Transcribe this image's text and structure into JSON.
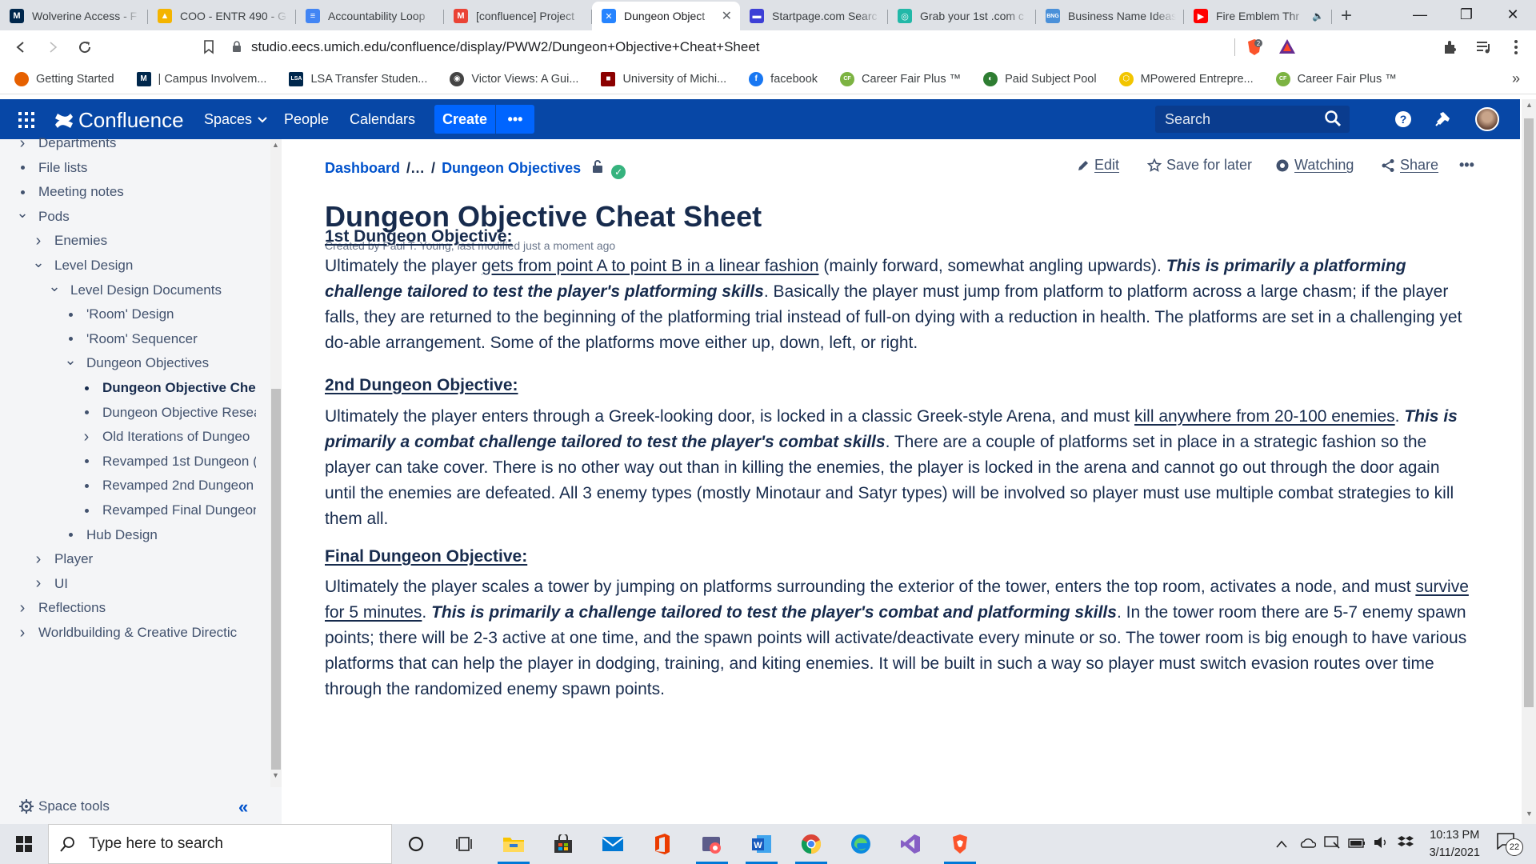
{
  "browser": {
    "tabs": [
      {
        "title": "Wolverine Access - F",
        "fav_color": "#00274c",
        "fav_text": "M"
      },
      {
        "title": "COO - ENTR 490 - G",
        "fav_color": "#f4b400",
        "fav_text": "▲"
      },
      {
        "title": "Accountability Loop",
        "fav_color": "#4285f4",
        "fav_text": "≡"
      },
      {
        "title": "[confluence] Project",
        "fav_color": "#ea4335",
        "fav_text": "M"
      },
      {
        "title": "Dungeon Object",
        "fav_color": "#2684ff",
        "fav_text": "✕"
      },
      {
        "title": "Startpage.com Searc",
        "fav_color": "#3d3fd6",
        "fav_text": "▬"
      },
      {
        "title": "Grab your 1st .com c",
        "fav_color": "#22b8a8",
        "fav_text": "◎"
      },
      {
        "title": "Business Name Ideas",
        "fav_color": "#4a90d9",
        "fav_text": "BNG"
      },
      {
        "title": "Fire Emblem Thr",
        "fav_color": "#ff0000",
        "fav_text": "▶"
      }
    ],
    "url": "studio.eecs.umich.edu/confluence/display/PWW2/Dungeon+Objective+Cheat+Sheet",
    "brave_badge": "2",
    "bookmarks": [
      {
        "label": "Getting Started",
        "color": "#e66000",
        "icon": ""
      },
      {
        "label": "| Campus Involvem...",
        "color": "#00274c",
        "icon": "M"
      },
      {
        "label": "LSA Transfer Studen...",
        "color": "#00274c",
        "icon": "LSA"
      },
      {
        "label": "Victor Views: A Gui...",
        "color": "#444444",
        "icon": "◉"
      },
      {
        "label": "University of Michi...",
        "color": "#8b0000",
        "icon": "■"
      },
      {
        "label": "facebook",
        "color": "#1877f2",
        "icon": "f"
      },
      {
        "label": "Career Fair Plus ™",
        "color": "#7cb342",
        "icon": "CF"
      },
      {
        "label": "Paid Subject Pool",
        "color": "#2e7d32",
        "icon": "◐"
      },
      {
        "label": "MPowered Entrepre...",
        "color": "#f2c500",
        "icon": "⬡"
      },
      {
        "label": "Career Fair Plus ™",
        "color": "#7cb342",
        "icon": "CF"
      }
    ]
  },
  "header": {
    "logo": "Confluence",
    "spaces": "Spaces",
    "people": "People",
    "calendars": "Calendars",
    "create": "Create",
    "more": "•••",
    "search_placeholder": "Search"
  },
  "sidebar": {
    "items": [
      {
        "label": "Departments",
        "level": 0,
        "type": "chevron-right"
      },
      {
        "label": "File lists",
        "level": 0,
        "type": "bullet"
      },
      {
        "label": "Meeting notes",
        "level": 0,
        "type": "bullet"
      },
      {
        "label": "Pods",
        "level": 0,
        "type": "chevron-down"
      },
      {
        "label": "Enemies",
        "level": 1,
        "type": "chevron-right"
      },
      {
        "label": "Level Design",
        "level": 1,
        "type": "chevron-down"
      },
      {
        "label": "Level Design Documents",
        "level": 2,
        "type": "chevron-down"
      },
      {
        "label": "'Room' Design",
        "level": 3,
        "type": "bullet"
      },
      {
        "label": "'Room' Sequencer",
        "level": 3,
        "type": "bullet"
      },
      {
        "label": "Dungeon Objectives",
        "level": 3,
        "type": "chevron-down"
      },
      {
        "label": "Dungeon Objective Che",
        "level": 4,
        "type": "bullet",
        "current": true
      },
      {
        "label": "Dungeon Objective Resea",
        "level": 4,
        "type": "bullet"
      },
      {
        "label": "Old Iterations of Dungeo",
        "level": 4,
        "type": "chevron-right"
      },
      {
        "label": "Revamped 1st Dungeon (",
        "level": 4,
        "type": "bullet"
      },
      {
        "label": "Revamped 2nd Dungeon",
        "level": 4,
        "type": "bullet"
      },
      {
        "label": "Revamped Final Dungeon",
        "level": 4,
        "type": "bullet"
      },
      {
        "label": "Hub Design",
        "level": 3,
        "type": "bullet"
      },
      {
        "label": "Player",
        "level": 1,
        "type": "chevron-right"
      },
      {
        "label": "UI",
        "level": 1,
        "type": "chevron-right"
      },
      {
        "label": "Reflections",
        "level": 0,
        "type": "chevron-right"
      },
      {
        "label": "Worldbuilding & Creative Directic",
        "level": 0,
        "type": "chevron-right"
      }
    ],
    "space_tools": "Space tools"
  },
  "page": {
    "breadcrumb": {
      "root": "Dashboard",
      "ellipsis": "/…",
      "sep": "/",
      "parent": "Dungeon Objectives"
    },
    "actions": {
      "edit": "Edit",
      "save": "Save for later",
      "watching": "Watching",
      "share": "Share",
      "more": "•••"
    },
    "title": "Dungeon Objective Cheat Sheet",
    "byline": "Created by Paul T. Young, last modified just a moment ago",
    "sections": [
      {
        "heading": "1st Dungeon Objective:",
        "p1": "Ultimately the player ",
        "u1": "gets from point A to point B in a linear fashion",
        "p2": " (mainly forward, somewhat angling upwards). ",
        "b1": "This is primarily a platforming challenge tailored to test the player's platforming skills",
        "p3": ". Basically the player must jump from platform to platform across a large chasm; if the player falls, they are returned to the beginning of the platforming trial instead of full-on dying with a reduction in health. The platforms are set in a challenging yet do-able arrangement. Some of the platforms move either up, down, left, or right."
      },
      {
        "heading": "2nd Dungeon Objective:",
        "p1": "Ultimately the player enters through a Greek-looking door, is locked in a classic Greek-style Arena, and must ",
        "u1": "kill anywhere from 20-100 enemies",
        "p2": ". ",
        "b1": "This is primarily a combat challenge tailored to test the player's combat skills",
        "p3": ". There are a couple of platforms set in place in a strategic fashion so the player can take cover. There is no other way out than in killing the enemies, the player is locked in the arena and cannot go out through the door again until the enemies are defeated. All 3 enemy types (mostly Minotaur and Satyr types) will be involved so player must use multiple combat strategies to kill them all."
      },
      {
        "heading": "Final Dungeon Objective:",
        "p1": "Ultimately the player scales a tower by jumping on platforms surrounding the exterior of the tower, enters the top room, activates a node, and must ",
        "u1": "survive for 5 minutes",
        "p2": ". ",
        "b1": "This is primarily a challenge tailored to test the player's combat and platforming skills",
        "p3": ". In the tower room there are 5-7 enemy spawn points; there will be 2-3 active at one time, and the spawn points will activate/deactivate every minute or so. The tower room is big enough to have various platforms that can help the player in dodging, training, and kiting enemies. It will be built in such a way so player must switch evasion routes over time through the randomized enemy spawn points."
      }
    ]
  },
  "taskbar": {
    "search_placeholder": "Type here to search",
    "time": "10:13 PM",
    "date": "3/11/2021",
    "notifications": "22"
  }
}
